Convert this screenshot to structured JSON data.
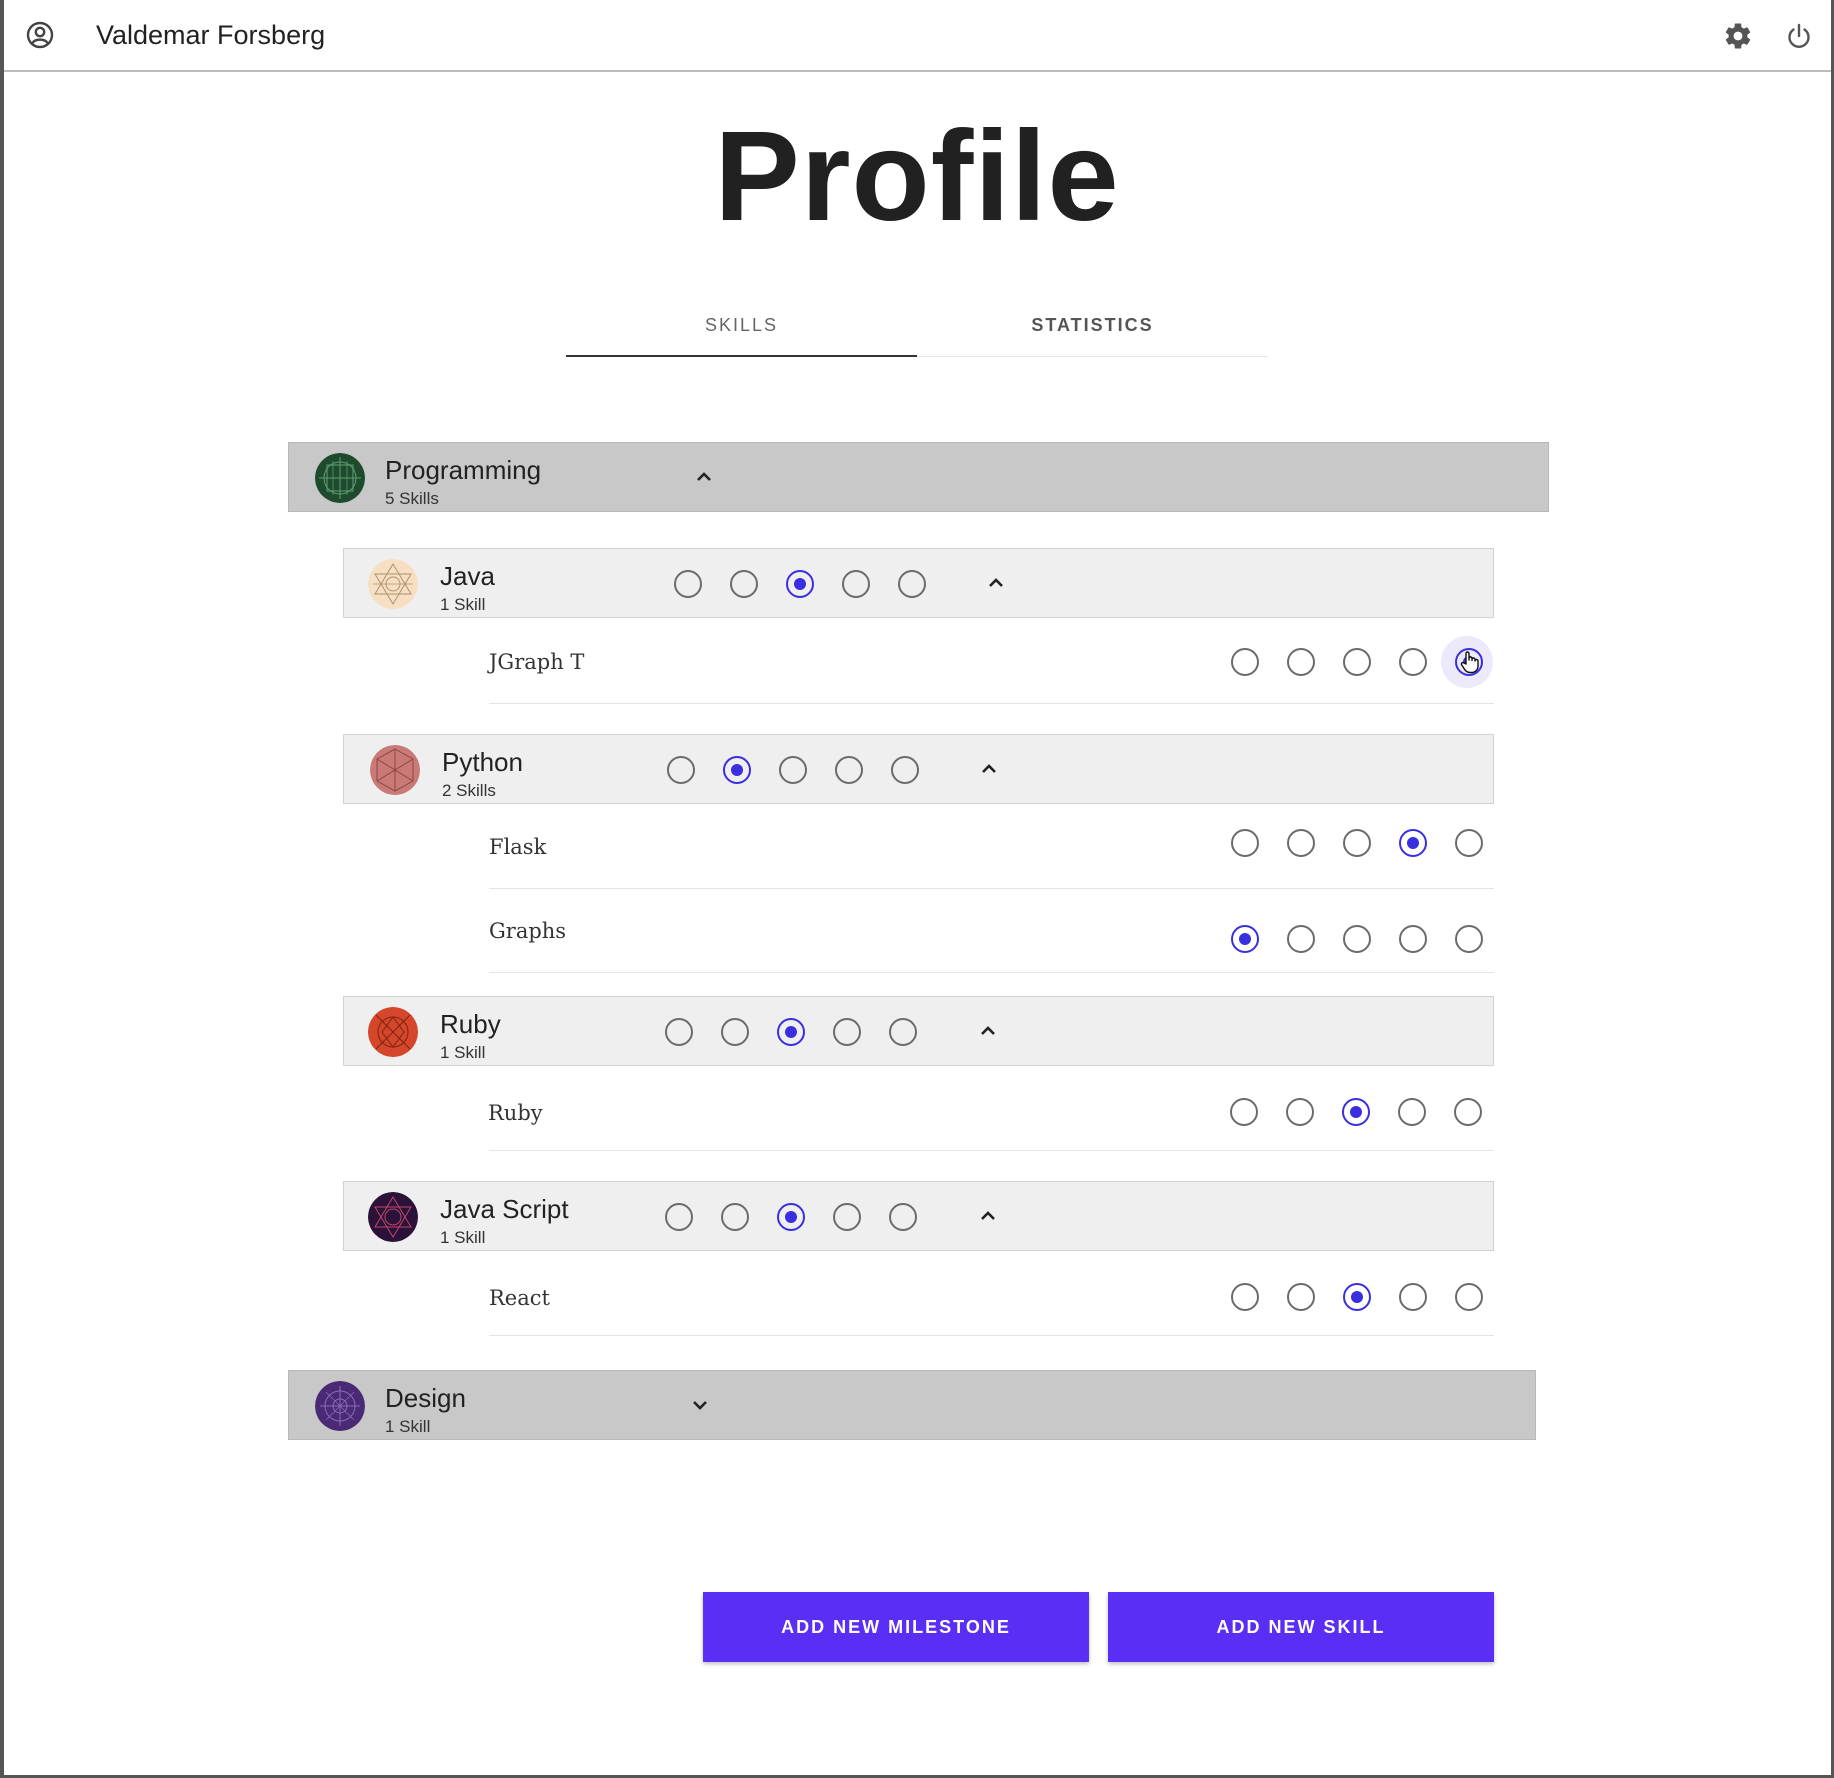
{
  "topbar": {
    "user_name": "Valdemar Forsberg",
    "icons": [
      "account-circle-icon",
      "gear-icon",
      "power-icon"
    ]
  },
  "page": {
    "title": "Profile"
  },
  "tabs": [
    {
      "label": "SKILLS",
      "active": true
    },
    {
      "label": "STATISTICS",
      "active": false
    }
  ],
  "categories": [
    {
      "name": "Programming",
      "count": "5 Skills",
      "expanded": true,
      "groups": [
        {
          "name": "Java",
          "count": "1 Skill",
          "level": 3,
          "skills": [
            {
              "name": "JGraph T",
              "level": 5
            }
          ]
        },
        {
          "name": "Python",
          "count": "2 Skills",
          "level": 2,
          "skills": [
            {
              "name": "Flask",
              "level": 4
            },
            {
              "name": "Graphs",
              "level": 1
            }
          ]
        },
        {
          "name": "Ruby",
          "count": "1 Skill",
          "level": 3,
          "skills": [
            {
              "name": "Ruby",
              "level": 3
            }
          ]
        },
        {
          "name": "Java Script",
          "count": "1 Skill",
          "level": 3,
          "skills": [
            {
              "name": "React",
              "level": 3
            }
          ]
        }
      ]
    },
    {
      "name": "Design",
      "count": "1 Skill",
      "expanded": false,
      "groups": []
    }
  ],
  "buttons": {
    "add_milestone": "ADD NEW MILESTONE",
    "add_skill": "ADD NEW SKILL"
  },
  "colors": {
    "accent": "#5b2ef5",
    "radio_selected": "#3a2fe0",
    "category_bg": "#c8c8c8",
    "group_bg": "#efefef"
  }
}
